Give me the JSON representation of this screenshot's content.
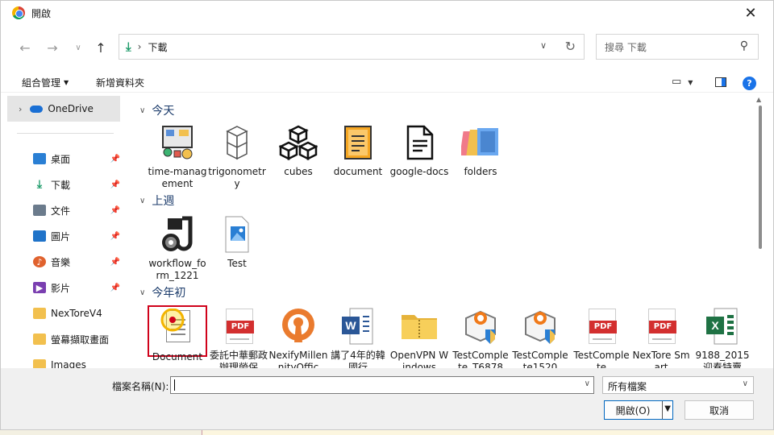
{
  "window": {
    "title": "開啟",
    "close_label": "✕"
  },
  "address": {
    "path": "下載",
    "icon": "download-icon"
  },
  "search": {
    "placeholder": "搜尋 下載"
  },
  "toolbar": {
    "organize_label": "組合管理",
    "new_folder_label": "新增資料夾",
    "help_label": "?"
  },
  "sidebar": {
    "onedrive_label": "OneDrive",
    "items": [
      {
        "label": "桌面",
        "icon": "desktop-icon",
        "color": "#2a7fd4"
      },
      {
        "label": "下載",
        "icon": "download-icon",
        "color": "#1e9b6a"
      },
      {
        "label": "文件",
        "icon": "documents-icon",
        "color": "#6b7b8c"
      },
      {
        "label": "圖片",
        "icon": "pictures-icon",
        "color": "#1f73c9"
      },
      {
        "label": "音樂",
        "icon": "music-icon",
        "color": "#e0622e"
      },
      {
        "label": "影片",
        "icon": "videos-icon",
        "color": "#7a3fb0"
      },
      {
        "label": "NexToreV4",
        "icon": "folder-icon",
        "color": "#f2c04e"
      },
      {
        "label": "螢幕擷取畫面",
        "icon": "folder-icon",
        "color": "#f2c04e"
      },
      {
        "label": "Images",
        "icon": "folder-icon",
        "color": "#f2c04e"
      }
    ]
  },
  "groups": [
    {
      "header": "今天",
      "files": [
        {
          "name": "time-management",
          "icon": "management-icon"
        },
        {
          "name": "trigonometry",
          "icon": "cube-grid-icon"
        },
        {
          "name": "cubes",
          "icon": "cubes-icon"
        },
        {
          "name": "document",
          "icon": "document-icon"
        },
        {
          "name": "google-docs",
          "icon": "google-docs-icon"
        },
        {
          "name": "folders",
          "icon": "folders-icon"
        }
      ]
    },
    {
      "header": "上週",
      "files": [
        {
          "name": "workflow_form_1221",
          "icon": "workflow-icon"
        },
        {
          "name": "Test",
          "icon": "image-file-icon"
        }
      ]
    },
    {
      "header": "今年初",
      "files": [
        {
          "name": "Document",
          "icon": "document-file-icon"
        },
        {
          "name": "委託中華郵政辦理勞保",
          "icon": "pdf-icon"
        },
        {
          "name": "NexifyMillennityOffic",
          "icon": "openvpn-icon"
        },
        {
          "name": "講了4年的韓國行",
          "icon": "word-icon"
        },
        {
          "name": "OpenVPN Windows",
          "icon": "zip-folder-icon"
        },
        {
          "name": "TestComplete_T6878",
          "icon": "testcomplete-icon"
        },
        {
          "name": "TestComplete1520",
          "icon": "testcomplete-icon"
        },
        {
          "name": "TestComplete",
          "icon": "pdf-icon"
        },
        {
          "name": "NexTore Smart",
          "icon": "pdf-icon"
        },
        {
          "name": "9188_2015迎春特賣",
          "icon": "excel-icon"
        }
      ]
    }
  ],
  "footer": {
    "filename_label": "檔案名稱(N):",
    "filename_value": "",
    "filetype_value": "所有檔案",
    "open_label": "開啟(O)",
    "cancel_label": "取消"
  }
}
